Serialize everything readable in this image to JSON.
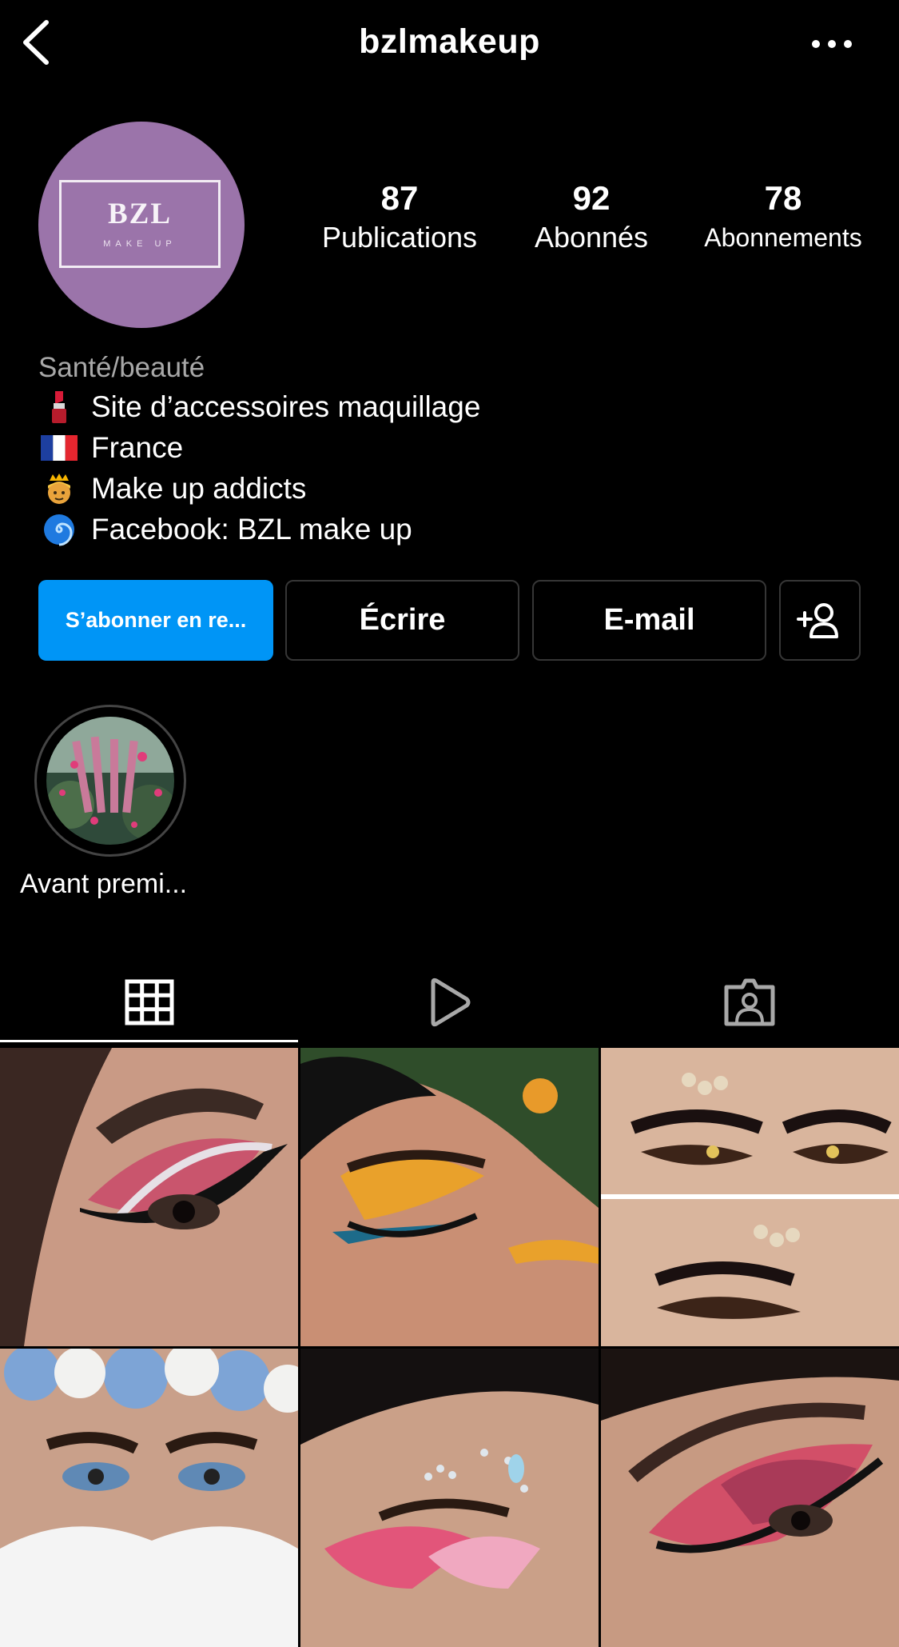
{
  "header": {
    "username": "bzlmakeup"
  },
  "profile": {
    "avatar": {
      "name": "BZL",
      "sub": "MAKE UP",
      "color": "#9b74aa"
    },
    "stats": [
      {
        "value": "87",
        "label": "Publications"
      },
      {
        "value": "92",
        "label": "Abonnés"
      },
      {
        "value": "78",
        "label": "Abonnements"
      }
    ],
    "category": "Santé/beauté",
    "bio": [
      {
        "icon": "lipstick-icon",
        "text": "Site d’accessoires maquillage"
      },
      {
        "icon": "france-flag-icon",
        "text": "France"
      },
      {
        "icon": "princess-icon",
        "text": "Make up addicts"
      },
      {
        "icon": "cyclone-icon",
        "text": "Facebook: BZL make up"
      }
    ]
  },
  "actions": {
    "subscribe": "S’abonner en re...",
    "message": "Écrire",
    "email": "E-mail"
  },
  "highlights": [
    {
      "label": "Avant premi..."
    }
  ],
  "tabs": [
    "grid-icon",
    "reels-icon",
    "tagged-icon"
  ],
  "colors": {
    "accent": "#0095f6",
    "background": "#000000",
    "muted": "#a8a8a8"
  }
}
